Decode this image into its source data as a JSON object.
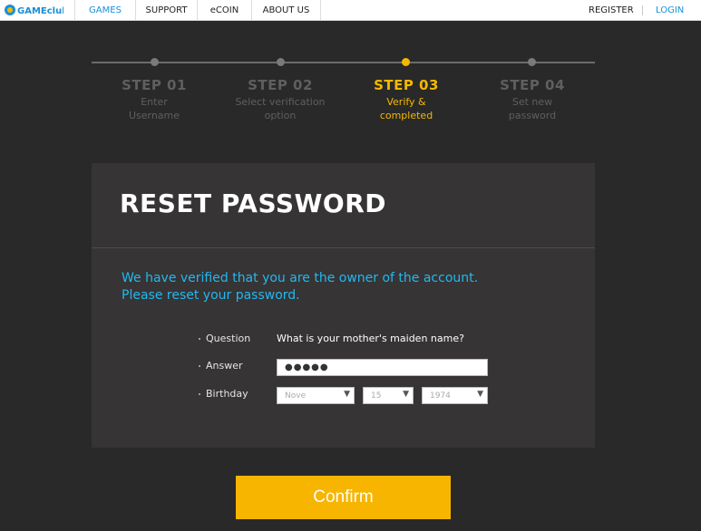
{
  "nav": {
    "logo_alt": "GAMEclub",
    "items": [
      {
        "label": "GAMES"
      },
      {
        "label": "SUPPORT"
      },
      {
        "label": "eCOIN"
      },
      {
        "label": "ABOUT US"
      }
    ],
    "register": "REGISTER",
    "login": "LOGIN"
  },
  "steps": [
    {
      "title": "STEP 01",
      "desc_line1": "Enter",
      "desc_line2": "Username"
    },
    {
      "title": "STEP 02",
      "desc_line1": "Select verification",
      "desc_line2": "option"
    },
    {
      "title": "STEP 03",
      "desc_line1": "Verify &",
      "desc_line2": "completed"
    },
    {
      "title": "STEP 04",
      "desc_line1": "Set new",
      "desc_line2": "password"
    }
  ],
  "panel": {
    "title": "RESET PASSWORD",
    "message_line1": "We have verified that you are the owner of the account.",
    "message_line2": "Please reset your password."
  },
  "form": {
    "question_label": "Question",
    "question_value": "What is your mother's maiden name?",
    "answer_label": "Answer",
    "answer_value": "●●●●●",
    "birthday_label": "Birthday",
    "birthday_month": "Nove",
    "birthday_day": "15",
    "birthday_year": "1974"
  },
  "confirm_label": "Confirm",
  "colors": {
    "accent": "#f5b800",
    "link": "#1a8fd8",
    "message": "#22b8f0"
  }
}
